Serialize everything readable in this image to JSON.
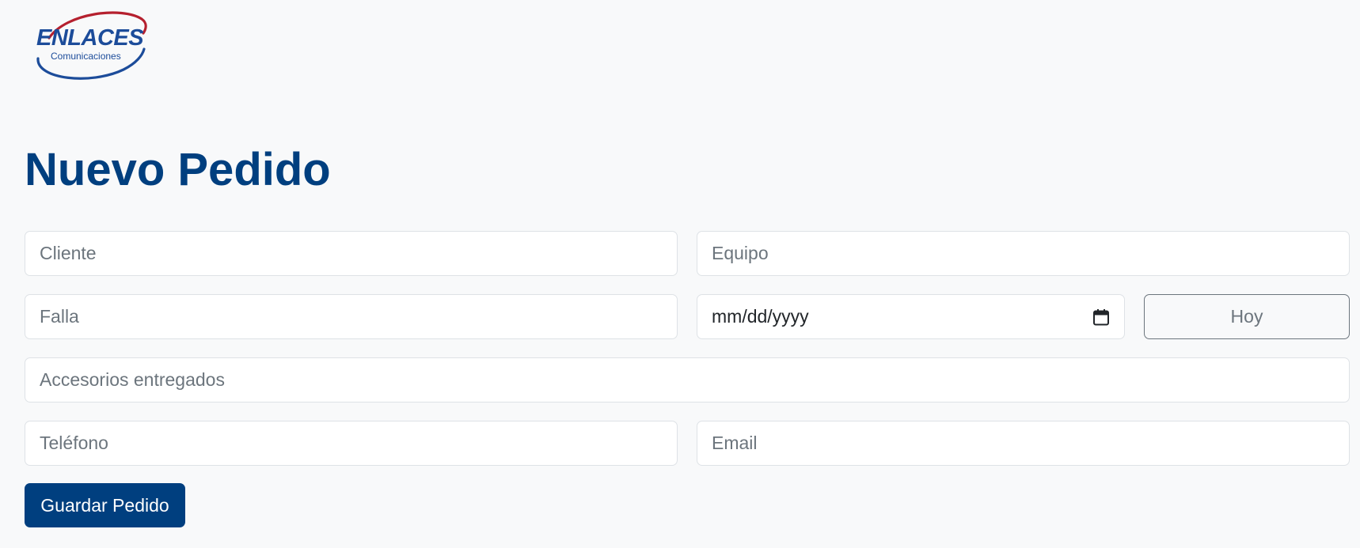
{
  "brand": {
    "name": "ENLACES",
    "tagline": "Comunicaciones",
    "colors": {
      "primary": "#1c4c9a",
      "swoosh_top": "#b5202e",
      "swoosh_bottom": "#1c4c9a"
    }
  },
  "page": {
    "title": "Nuevo Pedido"
  },
  "form": {
    "cliente": {
      "placeholder": "Cliente",
      "value": ""
    },
    "equipo": {
      "placeholder": "Equipo",
      "value": ""
    },
    "falla": {
      "placeholder": "Falla",
      "value": ""
    },
    "fecha": {
      "display": "mm/dd/yyyy",
      "icon": "calendar-icon"
    },
    "hoy_button": "Hoy",
    "accesorios": {
      "placeholder": "Accesorios entregados",
      "value": ""
    },
    "telefono": {
      "placeholder": "Teléfono",
      "value": ""
    },
    "email": {
      "placeholder": "Email",
      "value": ""
    },
    "save_button": "Guardar Pedido"
  },
  "theme": {
    "accent": "#003f7f",
    "background": "#f8f9fa",
    "border": "#dee2e6",
    "muted": "#6c757d"
  }
}
